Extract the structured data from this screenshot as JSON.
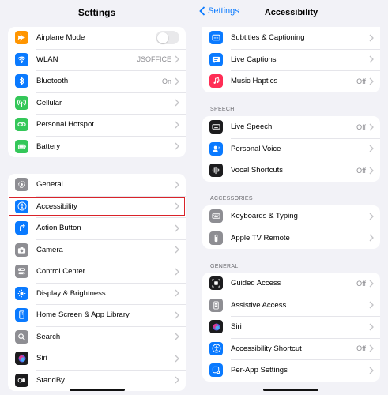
{
  "left": {
    "title": "Settings",
    "group1": [
      {
        "label": "Airplane Mode",
        "value": "",
        "icon": "airplane-icon",
        "color": "#ff9500",
        "toggle": true
      },
      {
        "label": "WLAN",
        "value": "JSOFFICE",
        "icon": "wifi-icon",
        "color": "#0a7aff"
      },
      {
        "label": "Bluetooth",
        "value": "On",
        "icon": "bluetooth-icon",
        "color": "#0a7aff"
      },
      {
        "label": "Cellular",
        "value": "",
        "icon": "antenna-icon",
        "color": "#34c759"
      },
      {
        "label": "Personal Hotspot",
        "value": "",
        "icon": "link-icon",
        "color": "#34c759"
      },
      {
        "label": "Battery",
        "value": "",
        "icon": "battery-icon",
        "color": "#34c759"
      }
    ],
    "group2": [
      {
        "label": "General",
        "icon": "gear-icon",
        "color": "#8e8e93"
      },
      {
        "label": "Accessibility",
        "icon": "accessibility-icon",
        "color": "#0a7aff"
      },
      {
        "label": "Action Button",
        "icon": "action-button-icon",
        "color": "#0a7aff"
      },
      {
        "label": "Camera",
        "icon": "camera-icon",
        "color": "#8e8e93"
      },
      {
        "label": "Control Center",
        "icon": "control-center-icon",
        "color": "#8e8e93"
      },
      {
        "label": "Display & Brightness",
        "icon": "sun-icon",
        "color": "#0a7aff"
      },
      {
        "label": "Home Screen & App Library",
        "icon": "home-screen-icon",
        "color": "#0a7aff"
      },
      {
        "label": "Search",
        "icon": "search-icon",
        "color": "#8e8e93"
      },
      {
        "label": "Siri",
        "icon": "siri-icon",
        "color": "#1c1c1e"
      },
      {
        "label": "StandBy",
        "icon": "standby-icon",
        "color": "#1c1c1e"
      }
    ]
  },
  "right": {
    "back_label": "Settings",
    "title": "Accessibility",
    "top_group": [
      {
        "label": "Subtitles & Captioning",
        "value": "",
        "icon": "subtitles-icon",
        "color": "#0a7aff"
      },
      {
        "label": "Live Captions",
        "value": "",
        "icon": "live-captions-icon",
        "color": "#0a7aff"
      },
      {
        "label": "Music Haptics",
        "value": "Off",
        "icon": "music-haptics-icon",
        "color": "#ff2d55"
      }
    ],
    "speech_header": "SPEECH",
    "speech_group": [
      {
        "label": "Live Speech",
        "value": "Off",
        "icon": "keyboard-speech-icon",
        "color": "#1c1c1e"
      },
      {
        "label": "Personal Voice",
        "value": "",
        "icon": "person-voice-icon",
        "color": "#0a7aff"
      },
      {
        "label": "Vocal Shortcuts",
        "value": "Off",
        "icon": "waveform-icon",
        "color": "#1c1c1e"
      }
    ],
    "accessories_header": "ACCESSORIES",
    "accessories_group": [
      {
        "label": "Keyboards & Typing",
        "value": "",
        "icon": "keyboard-icon",
        "color": "#8e8e93"
      },
      {
        "label": "Apple TV Remote",
        "value": "",
        "icon": "remote-icon",
        "color": "#8e8e93"
      }
    ],
    "general_header": "GENERAL",
    "general_group": [
      {
        "label": "Guided Access",
        "value": "Off",
        "icon": "guided-access-icon",
        "color": "#1c1c1e"
      },
      {
        "label": "Assistive Access",
        "value": "",
        "icon": "assistive-access-icon",
        "color": "#8e8e93"
      },
      {
        "label": "Siri",
        "value": "",
        "icon": "siri-icon",
        "color": "#1c1c1e"
      },
      {
        "label": "Accessibility Shortcut",
        "value": "Off",
        "icon": "accessibility-icon",
        "color": "#0a7aff"
      },
      {
        "label": "Per-App Settings",
        "value": "",
        "icon": "per-app-icon",
        "color": "#0a7aff"
      }
    ]
  },
  "colors": {
    "accent": "#0a7aff",
    "highlight": "#d9232a",
    "background": "#f2f2f7"
  }
}
